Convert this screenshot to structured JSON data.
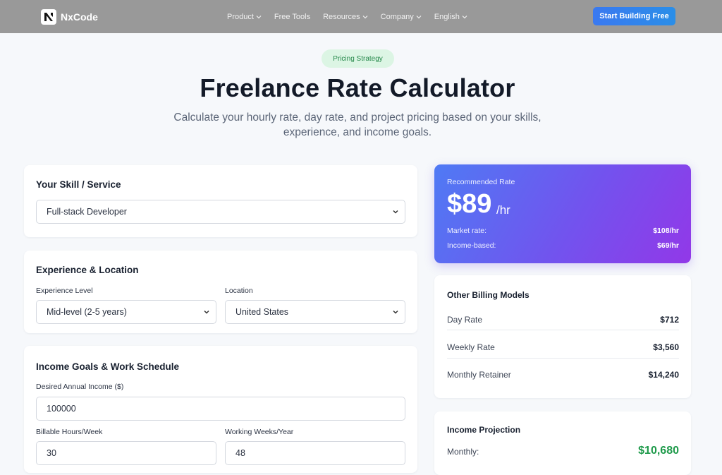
{
  "nav": {
    "brand": "NxCode",
    "items": [
      {
        "label": "Product",
        "has_dropdown": true
      },
      {
        "label": "Free Tools",
        "has_dropdown": false
      },
      {
        "label": "Resources",
        "has_dropdown": true
      },
      {
        "label": "Company",
        "has_dropdown": true
      },
      {
        "label": "English",
        "has_dropdown": true
      }
    ],
    "cta_label": "Start Building Free"
  },
  "hero": {
    "badge": "Pricing Strategy",
    "title": "Freelance Rate Calculator",
    "subtitle": "Calculate your hourly rate, day rate, and project pricing based on your skills, experience, and income goals."
  },
  "skill": {
    "title": "Your Skill / Service",
    "selected": "Full-stack Developer"
  },
  "experience": {
    "title": "Experience & Location",
    "level_label": "Experience Level",
    "level_value": "Mid-level (2-5 years)",
    "location_label": "Location",
    "location_value": "United States"
  },
  "income": {
    "title": "Income Goals & Work Schedule",
    "annual_label": "Desired Annual Income ($)",
    "annual_value": "100000",
    "hours_label": "Billable Hours/Week",
    "hours_value": "30",
    "weeks_label": "Working Weeks/Year",
    "weeks_value": "48"
  },
  "recommended": {
    "label": "Recommended Rate",
    "amount": "$89",
    "unit": "/hr",
    "market_label": "Market rate:",
    "market_value": "$108/hr",
    "income_label": "Income-based:",
    "income_value": "$69/hr"
  },
  "billing": {
    "title": "Other Billing Models",
    "rows": [
      {
        "label": "Day Rate",
        "value": "$712"
      },
      {
        "label": "Weekly Rate",
        "value": "$3,560"
      },
      {
        "label": "Monthly Retainer",
        "value": "$14,240"
      }
    ]
  },
  "projection": {
    "title": "Income Projection",
    "monthly_label": "Monthly:",
    "monthly_value": "$10,680"
  },
  "colors": {
    "nav_bg": "#999999",
    "cta": "#3a79f0",
    "badge_bg": "#dcf5e4",
    "badge_text": "#25884a",
    "gradient_start": "#4f7af4",
    "gradient_end": "#9238e8",
    "positive": "#1e9a4a"
  },
  "icons": {
    "logo": "nxcode-logo-icon",
    "dropdown": "chevron-down-icon"
  }
}
